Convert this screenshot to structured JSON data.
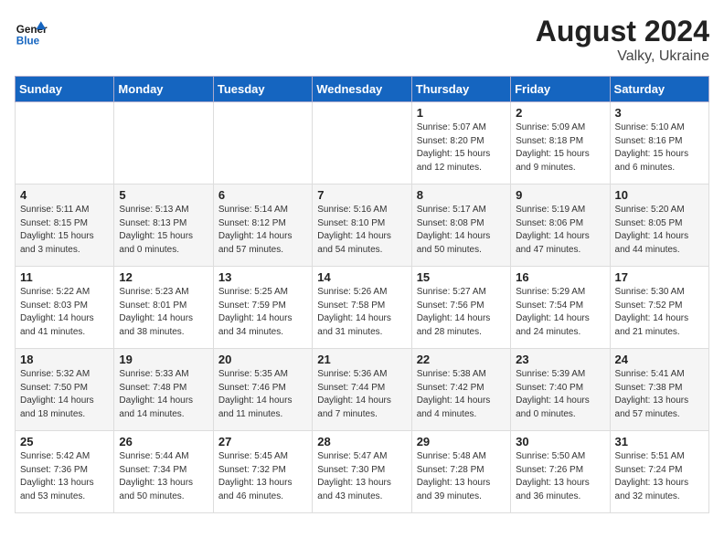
{
  "logo": {
    "line1": "General",
    "line2": "Blue"
  },
  "title": {
    "month_year": "August 2024",
    "location": "Valky, Ukraine"
  },
  "days_of_week": [
    "Sunday",
    "Monday",
    "Tuesday",
    "Wednesday",
    "Thursday",
    "Friday",
    "Saturday"
  ],
  "weeks": [
    [
      {
        "day": "",
        "info": ""
      },
      {
        "day": "",
        "info": ""
      },
      {
        "day": "",
        "info": ""
      },
      {
        "day": "",
        "info": ""
      },
      {
        "day": "1",
        "info": "Sunrise: 5:07 AM\nSunset: 8:20 PM\nDaylight: 15 hours\nand 12 minutes."
      },
      {
        "day": "2",
        "info": "Sunrise: 5:09 AM\nSunset: 8:18 PM\nDaylight: 15 hours\nand 9 minutes."
      },
      {
        "day": "3",
        "info": "Sunrise: 5:10 AM\nSunset: 8:16 PM\nDaylight: 15 hours\nand 6 minutes."
      }
    ],
    [
      {
        "day": "4",
        "info": "Sunrise: 5:11 AM\nSunset: 8:15 PM\nDaylight: 15 hours\nand 3 minutes."
      },
      {
        "day": "5",
        "info": "Sunrise: 5:13 AM\nSunset: 8:13 PM\nDaylight: 15 hours\nand 0 minutes."
      },
      {
        "day": "6",
        "info": "Sunrise: 5:14 AM\nSunset: 8:12 PM\nDaylight: 14 hours\nand 57 minutes."
      },
      {
        "day": "7",
        "info": "Sunrise: 5:16 AM\nSunset: 8:10 PM\nDaylight: 14 hours\nand 54 minutes."
      },
      {
        "day": "8",
        "info": "Sunrise: 5:17 AM\nSunset: 8:08 PM\nDaylight: 14 hours\nand 50 minutes."
      },
      {
        "day": "9",
        "info": "Sunrise: 5:19 AM\nSunset: 8:06 PM\nDaylight: 14 hours\nand 47 minutes."
      },
      {
        "day": "10",
        "info": "Sunrise: 5:20 AM\nSunset: 8:05 PM\nDaylight: 14 hours\nand 44 minutes."
      }
    ],
    [
      {
        "day": "11",
        "info": "Sunrise: 5:22 AM\nSunset: 8:03 PM\nDaylight: 14 hours\nand 41 minutes."
      },
      {
        "day": "12",
        "info": "Sunrise: 5:23 AM\nSunset: 8:01 PM\nDaylight: 14 hours\nand 38 minutes."
      },
      {
        "day": "13",
        "info": "Sunrise: 5:25 AM\nSunset: 7:59 PM\nDaylight: 14 hours\nand 34 minutes."
      },
      {
        "day": "14",
        "info": "Sunrise: 5:26 AM\nSunset: 7:58 PM\nDaylight: 14 hours\nand 31 minutes."
      },
      {
        "day": "15",
        "info": "Sunrise: 5:27 AM\nSunset: 7:56 PM\nDaylight: 14 hours\nand 28 minutes."
      },
      {
        "day": "16",
        "info": "Sunrise: 5:29 AM\nSunset: 7:54 PM\nDaylight: 14 hours\nand 24 minutes."
      },
      {
        "day": "17",
        "info": "Sunrise: 5:30 AM\nSunset: 7:52 PM\nDaylight: 14 hours\nand 21 minutes."
      }
    ],
    [
      {
        "day": "18",
        "info": "Sunrise: 5:32 AM\nSunset: 7:50 PM\nDaylight: 14 hours\nand 18 minutes."
      },
      {
        "day": "19",
        "info": "Sunrise: 5:33 AM\nSunset: 7:48 PM\nDaylight: 14 hours\nand 14 minutes."
      },
      {
        "day": "20",
        "info": "Sunrise: 5:35 AM\nSunset: 7:46 PM\nDaylight: 14 hours\nand 11 minutes."
      },
      {
        "day": "21",
        "info": "Sunrise: 5:36 AM\nSunset: 7:44 PM\nDaylight: 14 hours\nand 7 minutes."
      },
      {
        "day": "22",
        "info": "Sunrise: 5:38 AM\nSunset: 7:42 PM\nDaylight: 14 hours\nand 4 minutes."
      },
      {
        "day": "23",
        "info": "Sunrise: 5:39 AM\nSunset: 7:40 PM\nDaylight: 14 hours\nand 0 minutes."
      },
      {
        "day": "24",
        "info": "Sunrise: 5:41 AM\nSunset: 7:38 PM\nDaylight: 13 hours\nand 57 minutes."
      }
    ],
    [
      {
        "day": "25",
        "info": "Sunrise: 5:42 AM\nSunset: 7:36 PM\nDaylight: 13 hours\nand 53 minutes."
      },
      {
        "day": "26",
        "info": "Sunrise: 5:44 AM\nSunset: 7:34 PM\nDaylight: 13 hours\nand 50 minutes."
      },
      {
        "day": "27",
        "info": "Sunrise: 5:45 AM\nSunset: 7:32 PM\nDaylight: 13 hours\nand 46 minutes."
      },
      {
        "day": "28",
        "info": "Sunrise: 5:47 AM\nSunset: 7:30 PM\nDaylight: 13 hours\nand 43 minutes."
      },
      {
        "day": "29",
        "info": "Sunrise: 5:48 AM\nSunset: 7:28 PM\nDaylight: 13 hours\nand 39 minutes."
      },
      {
        "day": "30",
        "info": "Sunrise: 5:50 AM\nSunset: 7:26 PM\nDaylight: 13 hours\nand 36 minutes."
      },
      {
        "day": "31",
        "info": "Sunrise: 5:51 AM\nSunset: 7:24 PM\nDaylight: 13 hours\nand 32 minutes."
      }
    ]
  ]
}
